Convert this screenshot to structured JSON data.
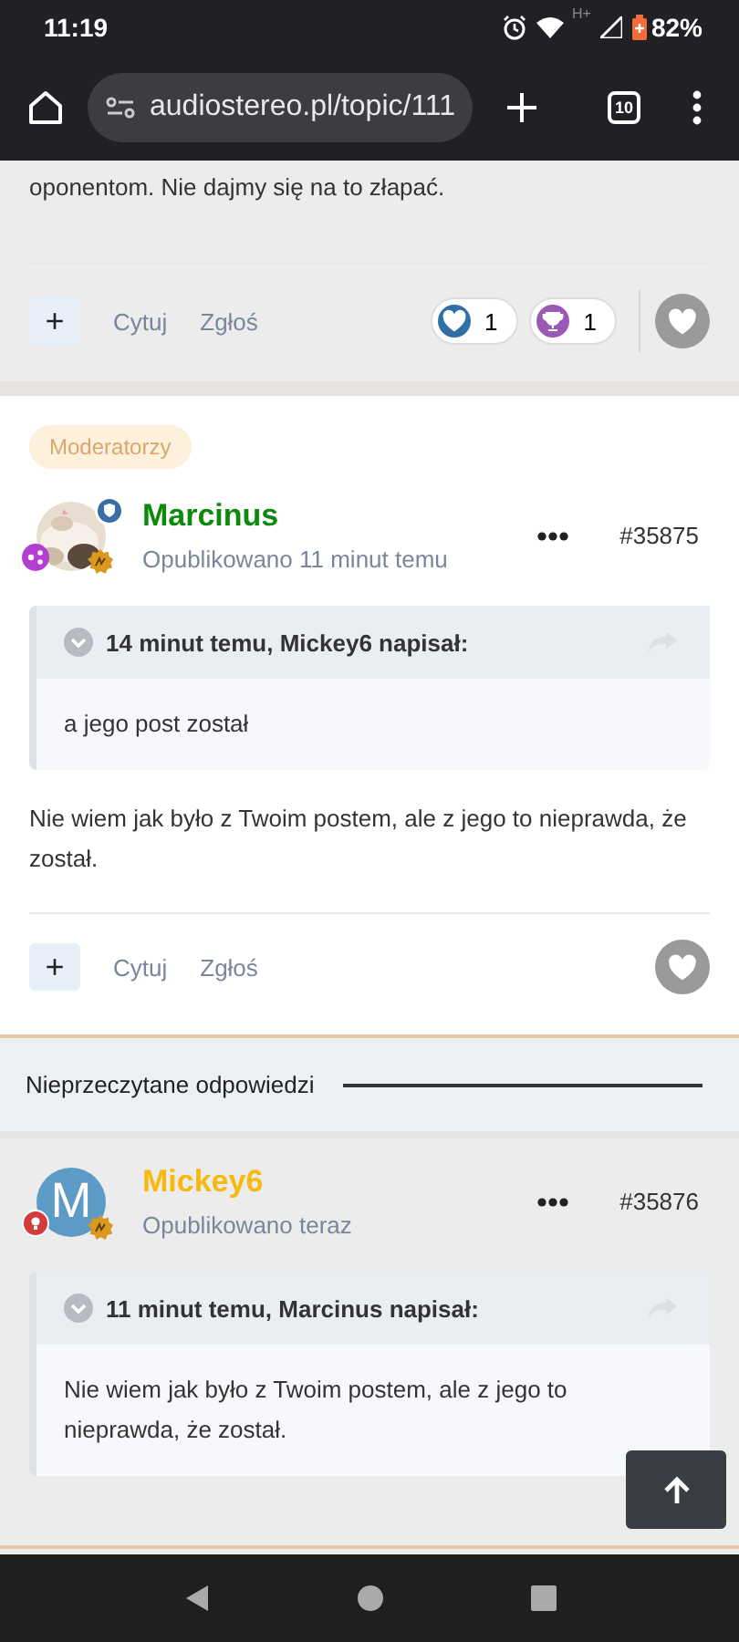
{
  "status_bar": {
    "time": "11:19",
    "network": "H+",
    "battery": "82%"
  },
  "browser": {
    "url": "audiostereo.pl/topic/111",
    "tab_count": "10"
  },
  "posts": [
    {
      "shaded": true,
      "body": "oponentom. Nie dajmy się na to złapać.",
      "actions": {
        "add": "+",
        "quote": "Cytuj",
        "report": "Zgłoś"
      },
      "reactions": [
        {
          "kind": "heart",
          "count": "1"
        },
        {
          "kind": "trophy",
          "count": "1"
        }
      ]
    },
    {
      "shaded": false,
      "group": "Moderatorzy",
      "author": {
        "name": "Marcinus",
        "color": "#0b8a0b"
      },
      "published": "Opublikowano 11 minut temu",
      "number": "#35875",
      "quote": {
        "header": "14 minut temu, Mickey6 napisał:",
        "text": "a jego post został"
      },
      "body": "Nie wiem jak było z Twoim postem, ale z jego to nieprawda, że został.",
      "actions": {
        "add": "+",
        "quote": "Cytuj",
        "report": "Zgłoś"
      }
    },
    {
      "kind": "separator",
      "label": "Nieprzeczytane odpowiedzi"
    },
    {
      "shaded": true,
      "author": {
        "name": "Mickey6",
        "color": "#f7b90f",
        "avatar": {
          "kind": "letter",
          "letter": "M"
        }
      },
      "published": "Opublikowano teraz",
      "number": "#35876",
      "quote": {
        "header": "11 minut temu, Marcinus napisał:",
        "text": "Nie wiem jak było z Twoim postem, ale z jego to nieprawda, że został."
      }
    }
  ]
}
